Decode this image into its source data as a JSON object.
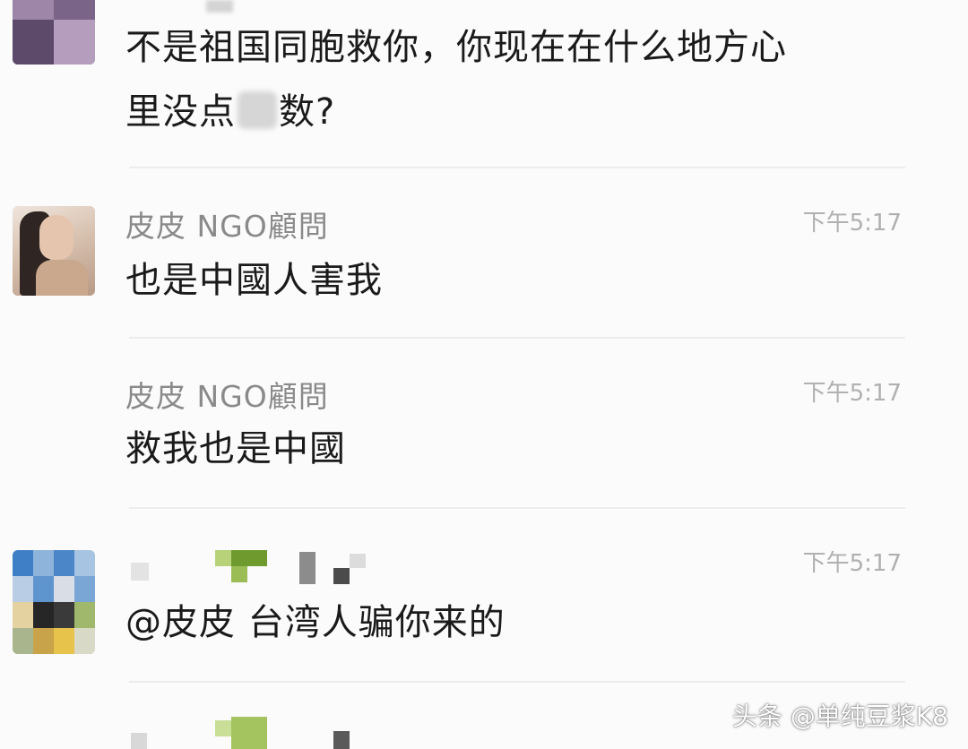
{
  "messages": [
    {
      "line1": "不是祖国同胞救你，你现在在什么地方心",
      "line2_before": "里没点",
      "line2_after": "数?"
    },
    {
      "sender": "皮皮 NGO顧問",
      "time": "下午5:17",
      "text": "也是中國人害我"
    },
    {
      "sender": "皮皮 NGO顧問",
      "time": "下午5:17",
      "text": "救我也是中國"
    },
    {
      "time": "下午5:17",
      "text": "@皮皮 台湾人骗你来的"
    }
  ],
  "watermark": "头条 @单纯豆浆K8",
  "colors": {
    "background": "#fbfbfb",
    "sender": "#8a8a8a",
    "time": "#b0b0b0",
    "text": "#1a1a1a"
  }
}
